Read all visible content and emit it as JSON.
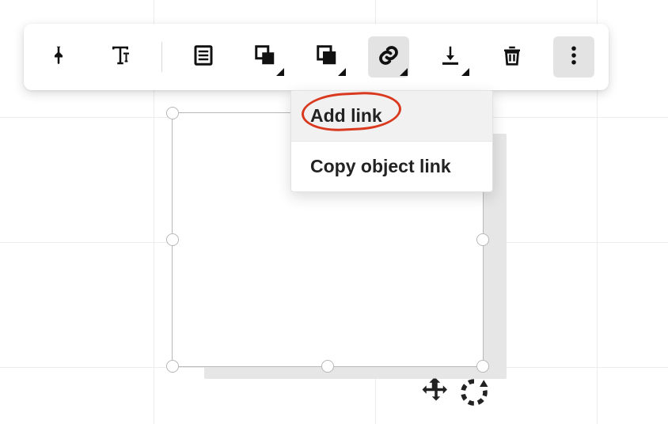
{
  "toolbar": {
    "buttons": [
      {
        "name": "pin",
        "opens_menu": false
      },
      {
        "name": "text",
        "opens_menu": false
      },
      {
        "name": "list",
        "opens_menu": false
      },
      {
        "name": "arrange",
        "opens_menu": true
      },
      {
        "name": "copy",
        "opens_menu": true
      },
      {
        "name": "link",
        "opens_menu": true,
        "active": true
      },
      {
        "name": "download",
        "opens_menu": true
      },
      {
        "name": "delete",
        "opens_menu": false
      },
      {
        "name": "more",
        "opens_menu": false,
        "active": true
      }
    ]
  },
  "link_menu": {
    "items": [
      {
        "label": "Add link",
        "highlighted": true
      },
      {
        "label": "Copy object link",
        "highlighted": false
      }
    ]
  },
  "selection": {
    "object_type": "rectangle",
    "handle_count": 7
  },
  "annotation": {
    "shape": "oval",
    "target": "Add link",
    "stroke": "#d93a1f"
  }
}
